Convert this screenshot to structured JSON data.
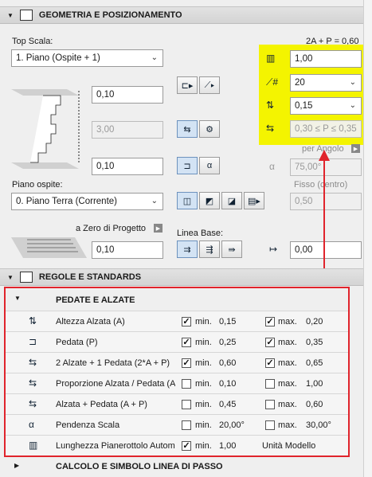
{
  "geometry": {
    "header_title": "GEOMETRIA E POSIZIONAMENTO",
    "formula": "2A + P = 0,60",
    "top_label": "Top Scala:",
    "top_select": "1. Piano (Ospite + 1)",
    "top_offset": "0,10",
    "height_value": "3,00",
    "bottom_offset": "0,10",
    "piano_ospite_label": "Piano ospite:",
    "piano_ospite_select": "0. Piano Terra (Corrente)",
    "zero_label": "a Zero di Progetto",
    "zero_value": "0,10",
    "yellow_fields": {
      "risers_count": "1,00",
      "num_risers": "20",
      "riser_height": "0,15",
      "tread_range": "0,30 ≤ P ≤ 0,35"
    },
    "per_angolo": "per Angolo",
    "angle_value": "75,00°",
    "fisso_label": "Fisso (centro)",
    "fisso_value": "0,50",
    "linea_base_label": "Linea Base:",
    "linea_base_value": "0,00"
  },
  "rules": {
    "header_title": "REGOLE E STANDARDS",
    "subsection_title": "PEDATE E ALZATE",
    "min_label": "min.",
    "max_label": "max.",
    "rows": [
      {
        "label": "Altezza Alzata (A)",
        "min_checked": true,
        "min": "0,15",
        "max_checked": true,
        "max": "0,20"
      },
      {
        "label": "Pedata (P)",
        "min_checked": true,
        "min": "0,25",
        "max_checked": true,
        "max": "0,35"
      },
      {
        "label": "2 Alzate + 1 Pedata (2*A + P)",
        "min_checked": true,
        "min": "0,60",
        "max_checked": true,
        "max": "0,65"
      },
      {
        "label": "Proporzione Alzata / Pedata (A/P)",
        "min_checked": false,
        "min": "0,10",
        "max_checked": false,
        "max": "1,00"
      },
      {
        "label": "Alzata + Pedata (A + P)",
        "min_checked": false,
        "min": "0,45",
        "max_checked": false,
        "max": "0,60"
      },
      {
        "label": "Pendenza Scala",
        "min_checked": false,
        "min": "20,00°",
        "max_checked": false,
        "max": "30,00°"
      }
    ],
    "landing": {
      "label": "Lunghezza Pianerottolo Automatico",
      "min_checked": true,
      "min": "1,00",
      "unit_label": "Unità Modello"
    },
    "next_section": "CALCOLO E SIMBOLO LINEA DI PASSO"
  },
  "colors": {
    "highlight_yellow": "#f4f400",
    "annotation_red": "#e0242c"
  },
  "icons": [
    "stair-icon",
    "checkmark-icon",
    "triangle-down-icon",
    "triangle-right-icon"
  ]
}
